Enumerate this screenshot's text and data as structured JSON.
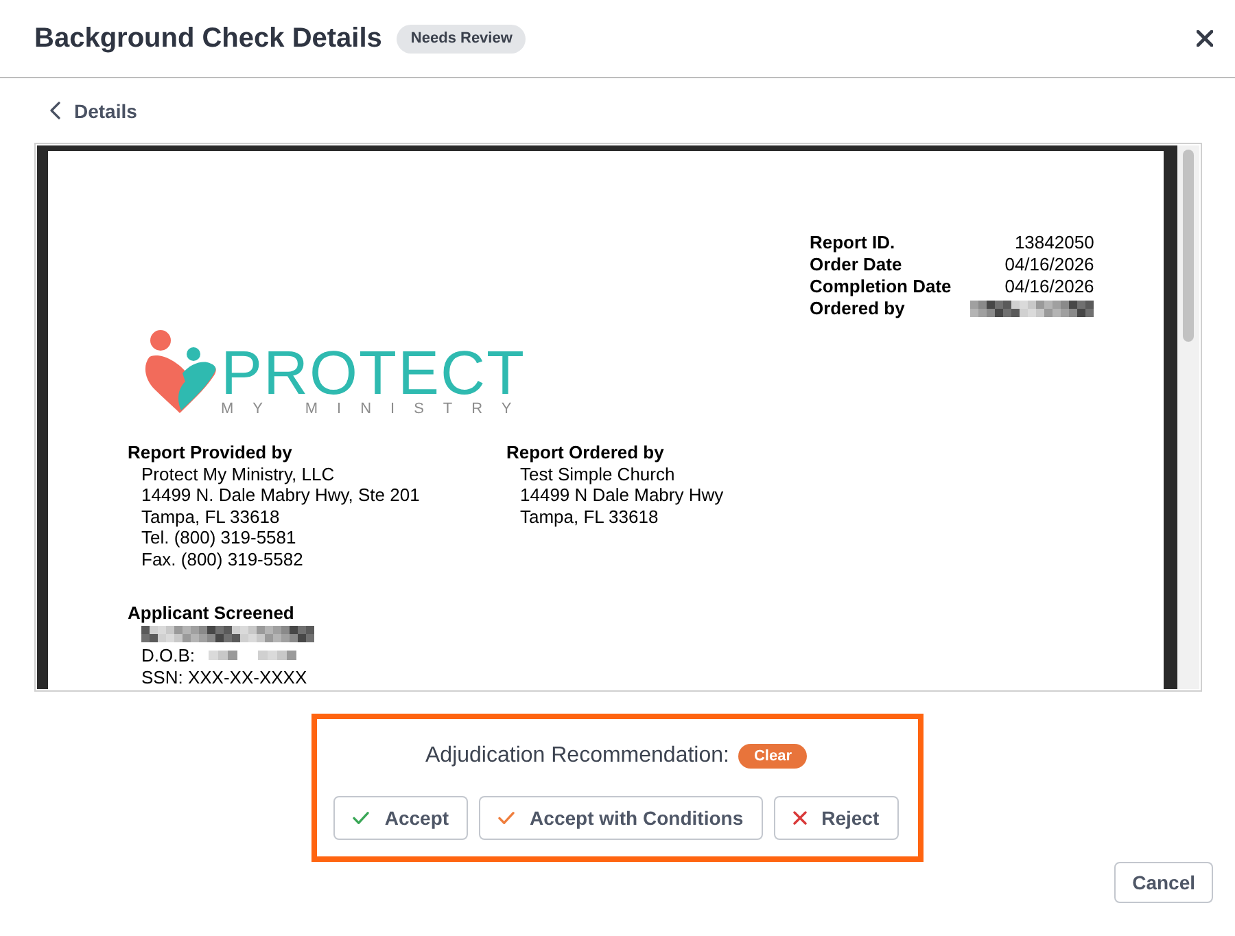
{
  "dialog": {
    "title": "Background Check Details",
    "status_badge": "Needs Review"
  },
  "back_link": {
    "label": "Details"
  },
  "report": {
    "info": [
      {
        "kind": "text",
        "label": "Report ID.",
        "value": "13842050"
      },
      {
        "kind": "text",
        "label": "Order Date",
        "value": "04/16/2026"
      },
      {
        "kind": "text",
        "label": "Completion Date",
        "value": "04/16/2026"
      },
      {
        "kind": "redacted",
        "label": "Ordered by"
      }
    ],
    "logo": {
      "name": "PROTECT",
      "tagline": "MY MINISTRY"
    },
    "parties": [
      {
        "heading": "Report Provided by",
        "lines": [
          "Protect My Ministry, LLC",
          "14499 N. Dale Mabry Hwy, Ste 201",
          "Tampa, FL 33618",
          "Tel. (800) 319-5581",
          "Fax. (800) 319-5582"
        ]
      },
      {
        "heading": "Report Ordered by",
        "lines": [
          "Test Simple Church",
          "14499 N Dale Mabry Hwy",
          "Tampa, FL 33618"
        ]
      }
    ],
    "applicant": {
      "heading": "Applicant Screened",
      "lines": [
        {
          "kind": "redacted"
        },
        {
          "kind": "redacted-field",
          "label": "D.O.B:"
        },
        {
          "kind": "text",
          "text": "SSN: XXX-XX-XXXX"
        }
      ]
    }
  },
  "adjudication": {
    "highlighted": true,
    "label": "Adjudication Recommendation:",
    "recommendation": "Clear",
    "actions": [
      {
        "kind": "accept",
        "label": "Accept"
      },
      {
        "kind": "conditional",
        "label": "Accept with Conditions"
      },
      {
        "kind": "reject",
        "label": "Reject"
      }
    ]
  },
  "footer": {
    "buttons": [
      {
        "kind": "cancel",
        "label": "Cancel"
      }
    ]
  }
}
